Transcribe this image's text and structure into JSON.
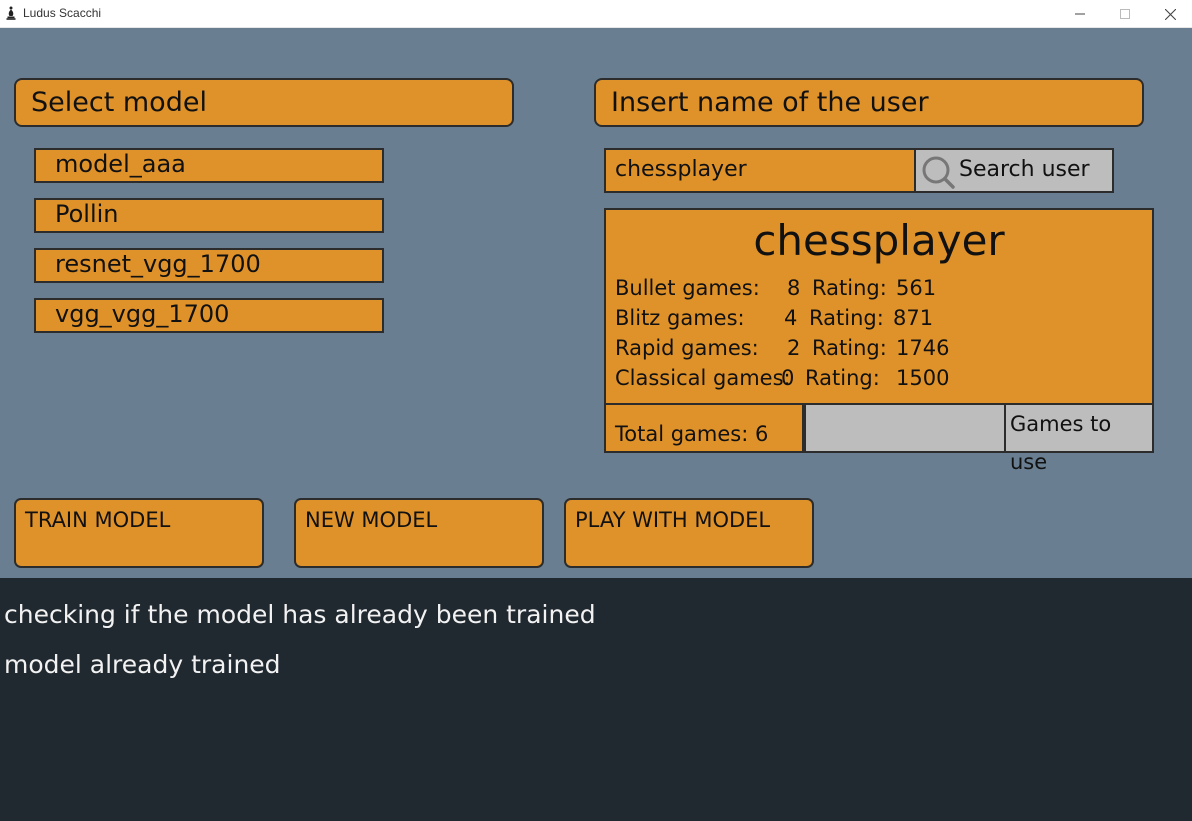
{
  "window": {
    "title": "Ludus Scacchi",
    "icon": "chess-bishop-icon"
  },
  "colors": {
    "panel": "#697f91",
    "accent": "#e0922a",
    "console": "#202830",
    "gray": "#bdbdbd"
  },
  "models": {
    "header": "Select model",
    "items": [
      "model_aaa",
      "Pollin",
      "resnet_vgg_1700",
      "vgg_vgg_1700"
    ]
  },
  "user": {
    "header": "Insert name of the user",
    "input_value": "chessplayer",
    "search_label": "Search user"
  },
  "card": {
    "username": "chessplayer",
    "stats": [
      {
        "label": "Bullet games:",
        "games": "8",
        "rating_label": "Rating:",
        "rating": "561"
      },
      {
        "label": "Blitz games:",
        "games": "4",
        "rating_label": "Rating:",
        "rating": "871"
      },
      {
        "label": "Rapid games:",
        "games": "2",
        "rating_label": "Rating:",
        "rating": "1746"
      },
      {
        "label": "Classical games:",
        "games": "0",
        "rating_label": "Rating:",
        "rating": "1500"
      }
    ],
    "total_games": "Total games: 6",
    "games_to_use_value": "",
    "games_to_use_label": "Games to use"
  },
  "actions": {
    "train": "TRAIN MODEL",
    "new": "NEW MODEL",
    "play": "PLAY WITH MODEL"
  },
  "console": {
    "lines": [
      "checking if the model has already been trained",
      "model already trained"
    ]
  }
}
